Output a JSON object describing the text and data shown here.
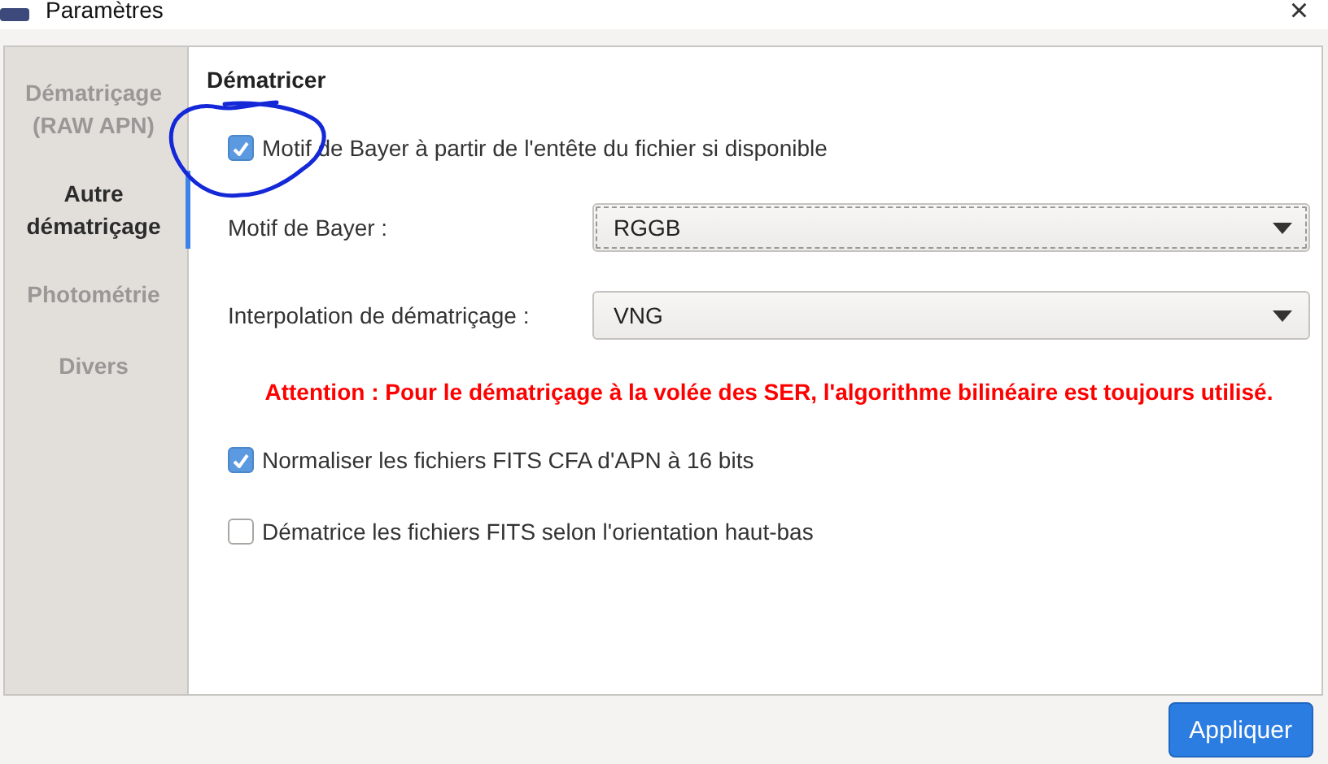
{
  "window": {
    "title": "Paramètres",
    "close": "×"
  },
  "sidebar": {
    "items": [
      {
        "label": "Dématriçage (RAW APN)",
        "selected": false
      },
      {
        "label": "Autre dématriçage",
        "selected": true
      },
      {
        "label": "Photométrie",
        "selected": false
      },
      {
        "label": "Divers",
        "selected": false
      }
    ]
  },
  "content": {
    "heading": "Dématricer",
    "items": [
      {
        "kind": "checkbox",
        "label": "Motif de Bayer à partir de l'entête du fichier si disponible",
        "checked": true
      },
      {
        "kind": "select",
        "label": "Motif de Bayer :",
        "value": "RGGB",
        "focused": true
      },
      {
        "kind": "select",
        "label": "Interpolation de dématriçage :",
        "value": "VNG",
        "focused": false
      },
      {
        "kind": "warning",
        "text": "Attention : Pour le dématriçage à la volée des SER, l'algorithme bilinéaire est toujours utilisé."
      },
      {
        "kind": "checkbox",
        "label": "Normaliser les fichiers FITS CFA d'APN à 16 bits",
        "checked": true
      },
      {
        "kind": "checkbox",
        "label": "Dématrice les fichiers FITS selon l'orientation haut-bas",
        "checked": false
      }
    ]
  },
  "buttons": [
    "Appliquer"
  ]
}
